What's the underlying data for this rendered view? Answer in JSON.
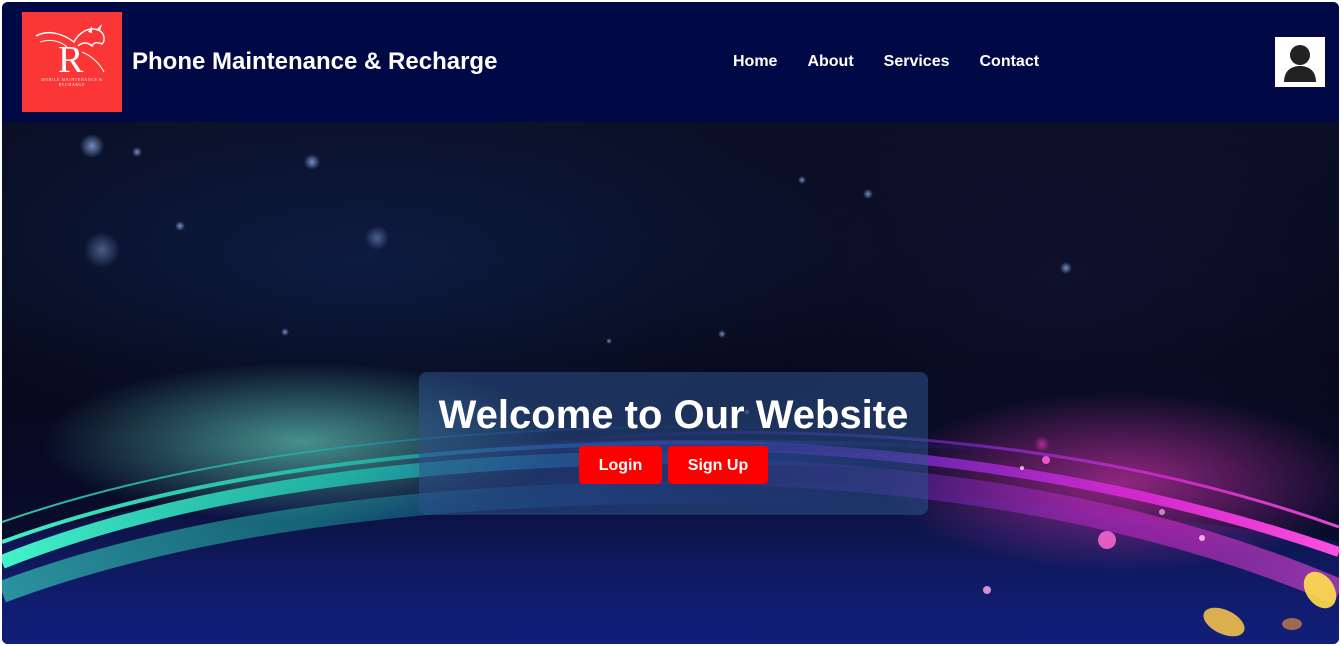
{
  "header": {
    "logo": {
      "letter": "R",
      "tagline": "Mobile Maintenance & Recharge",
      "icon": "dragon-logo-icon",
      "background_color": "#fb3636"
    },
    "title": "Phone Maintenance & Recharge",
    "nav": [
      {
        "label": "Home"
      },
      {
        "label": "About"
      },
      {
        "label": "Services"
      },
      {
        "label": "Contact"
      }
    ],
    "profile_icon": "user-icon",
    "background_color": "#000845"
  },
  "hero": {
    "heading": "Welcome to Our Website",
    "buttons": {
      "login_label": "Login",
      "signup_label": "Sign Up"
    },
    "button_color": "#ff0000"
  }
}
